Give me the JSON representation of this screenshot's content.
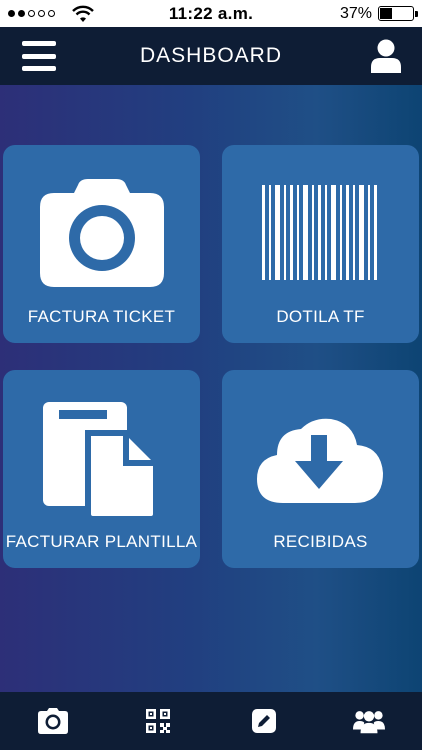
{
  "status_bar": {
    "time": "11:22 a.m.",
    "battery_percent": "37%",
    "battery_level": 0.37,
    "signal_bars_filled": 2,
    "signal_bars_total": 5
  },
  "header": {
    "title": "DASHBOARD",
    "menu_icon": "hamburger-menu-icon",
    "profile_icon": "user-icon"
  },
  "tiles": [
    {
      "label": "FACTURA TICKET",
      "icon": "camera-icon"
    },
    {
      "label": "DOTILA TF",
      "icon": "barcode-icon"
    },
    {
      "label": "FACTURAR PLANTILLA",
      "icon": "documents-icon"
    },
    {
      "label": "RECIBIDAS",
      "icon": "cloud-download-icon"
    }
  ],
  "bottom_nav": [
    {
      "icon": "camera-icon"
    },
    {
      "icon": "qr-code-icon"
    },
    {
      "icon": "edit-icon"
    },
    {
      "icon": "group-icon"
    }
  ],
  "colors": {
    "header_bg": "#0e1d35",
    "tile_bg": "#2e6aa8",
    "icon_color": "#ffffff"
  }
}
